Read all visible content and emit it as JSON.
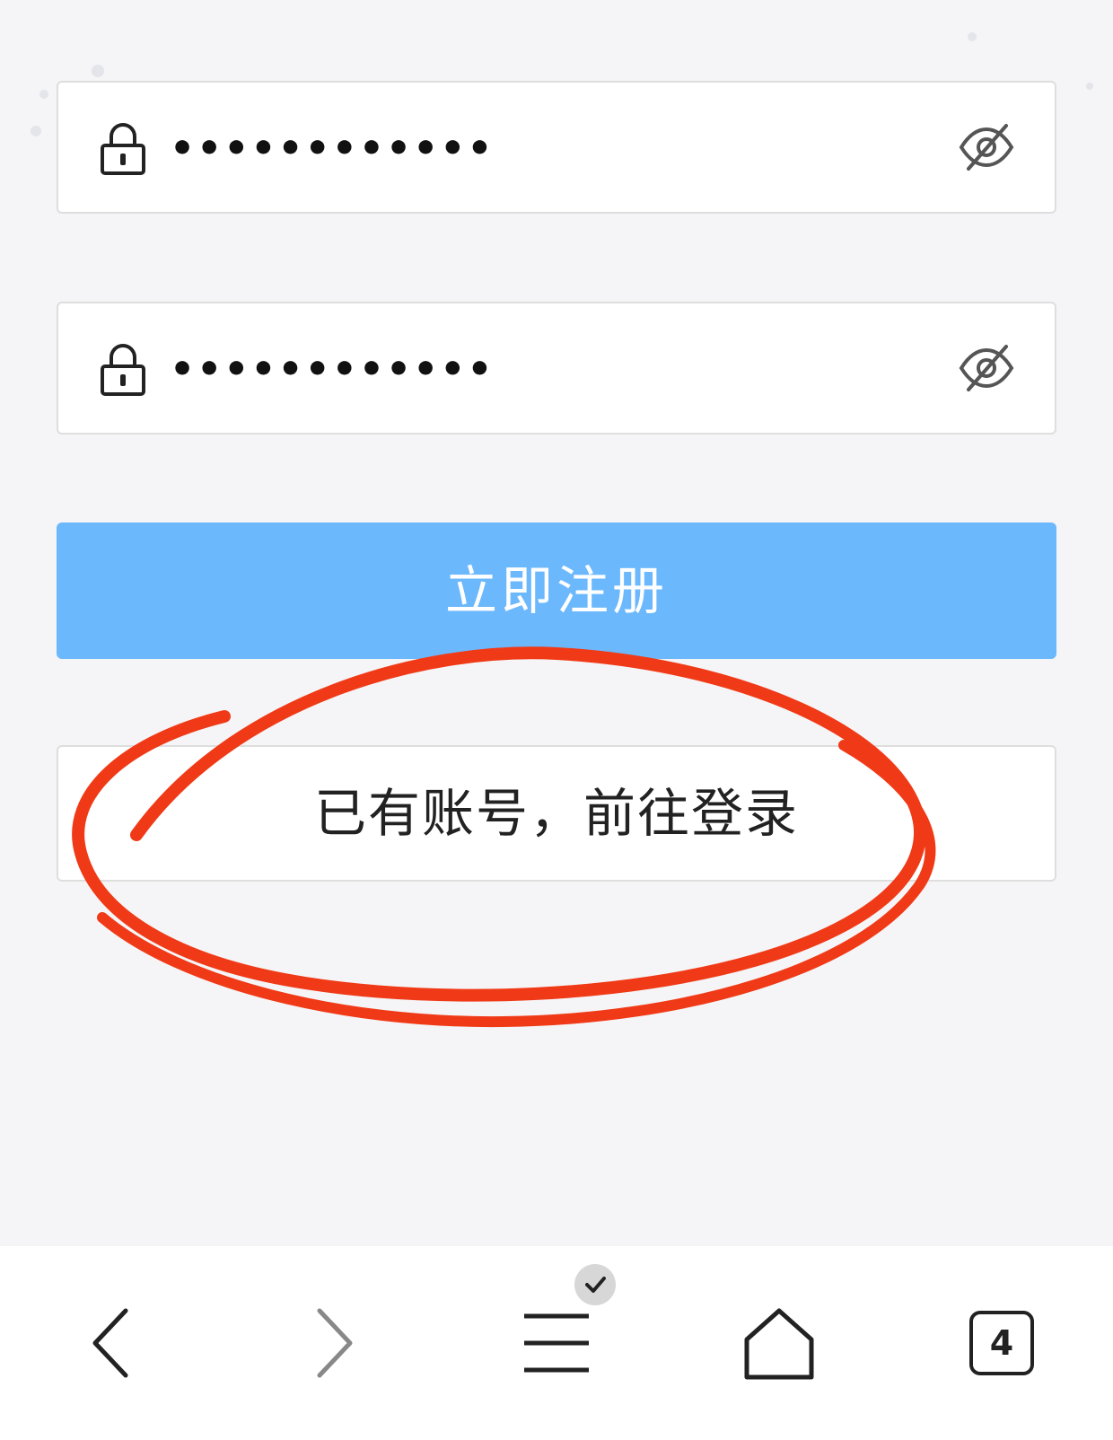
{
  "form": {
    "password": {
      "icon": "lock-icon",
      "value": "••••••••••••",
      "toggle_icon": "eye-off-icon"
    },
    "confirm_password": {
      "icon": "lock-icon",
      "value": "••••••••••••",
      "toggle_icon": "eye-off-icon"
    },
    "register_label": "立即注册",
    "login_label": "已有账号，前往登录"
  },
  "annotation": {
    "type": "hand-drawn circle",
    "color": "#f03a17"
  },
  "bottom_nav": {
    "items": [
      {
        "icon": "back-icon"
      },
      {
        "icon": "forward-icon"
      },
      {
        "icon": "menu-icon",
        "badge_icon": "check-icon"
      },
      {
        "icon": "home-icon"
      },
      {
        "icon": "tabs-icon",
        "count": "4"
      }
    ]
  },
  "colors": {
    "primary_button": "#6cb8fc",
    "background": "#f5f5f7",
    "annotation": "#f03a17"
  }
}
